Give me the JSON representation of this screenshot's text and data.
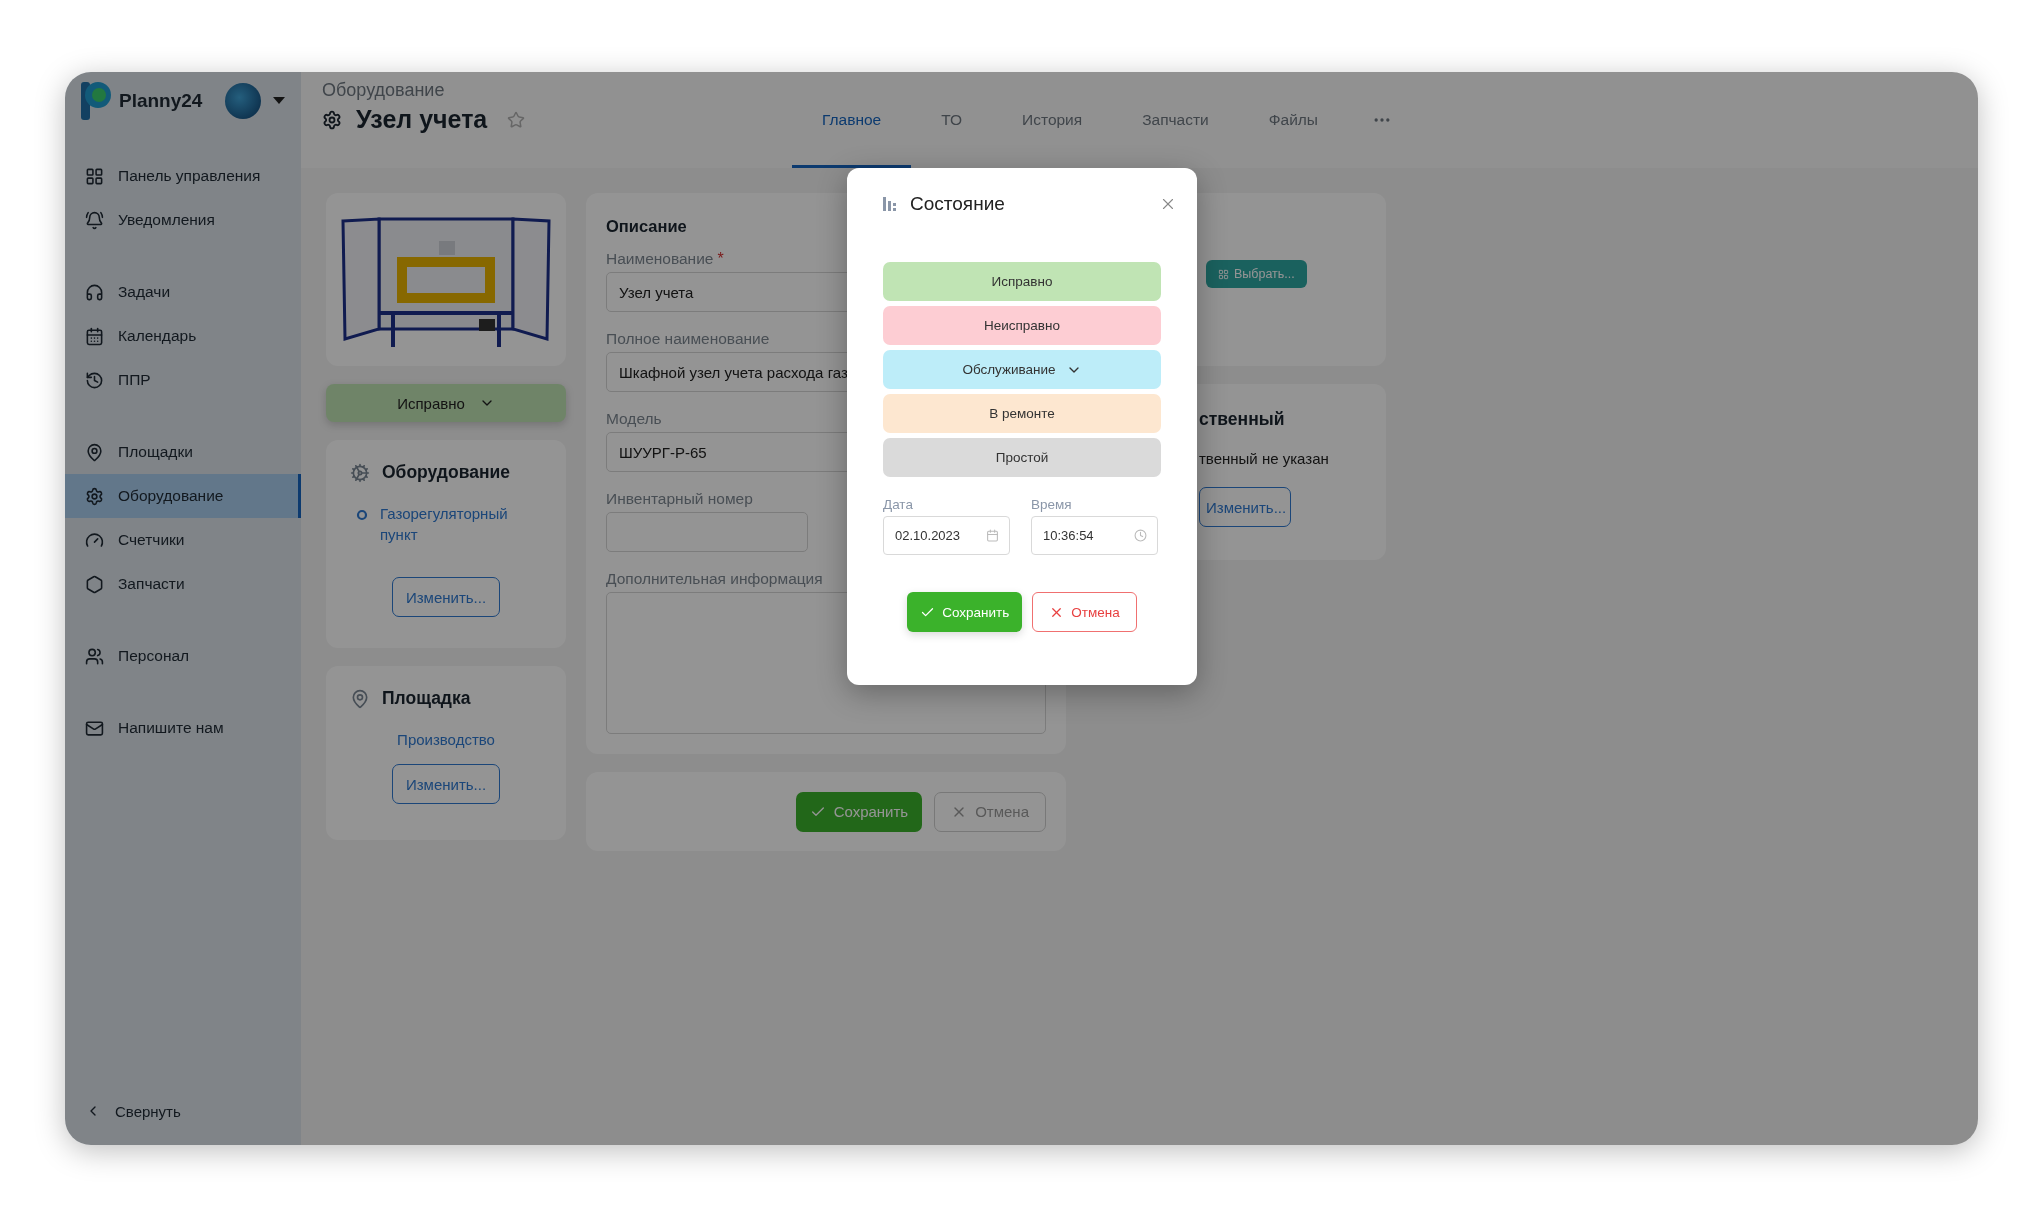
{
  "app": {
    "name": "Planny24"
  },
  "sidebar": {
    "groups": [
      [
        {
          "label": "Панель управления",
          "selected": false
        },
        {
          "label": "Уведомления",
          "selected": false
        }
      ],
      [
        {
          "label": "Задачи",
          "selected": false
        },
        {
          "label": "Календарь",
          "selected": false
        },
        {
          "label": "ППР",
          "selected": false
        }
      ],
      [
        {
          "label": "Площадки",
          "selected": false
        },
        {
          "label": "Оборудование",
          "selected": true
        },
        {
          "label": "Счетчики",
          "selected": false
        },
        {
          "label": "Запчасти",
          "selected": false
        }
      ],
      [
        {
          "label": "Персонал",
          "selected": false
        }
      ],
      [
        {
          "label": "Напишите нам",
          "selected": false
        }
      ]
    ],
    "collapse": "Свернуть"
  },
  "header": {
    "breadcrumb": "Оборудование",
    "title": "Узел учета",
    "starred": false,
    "tabs": [
      {
        "label": "Главное",
        "selected": true
      },
      {
        "label": "ТО",
        "selected": false
      },
      {
        "label": "История",
        "selected": false
      },
      {
        "label": "Запчасти",
        "selected": false
      },
      {
        "label": "Файлы",
        "selected": false
      }
    ]
  },
  "status_button": {
    "label": "Исправно"
  },
  "equipment_card": {
    "title": "Оборудование",
    "items": [
      {
        "label": "Газорегуляторный пункт"
      }
    ],
    "button": "Изменить..."
  },
  "site_card": {
    "title": "Площадка",
    "link": "Производство",
    "button": "Изменить..."
  },
  "description": {
    "title": "Описание",
    "fields": [
      {
        "kind": "text",
        "label": "Наименование",
        "required_mark": "*",
        "value": "Узел учета"
      },
      {
        "kind": "text",
        "label": "Полное наименование",
        "value": "Шкафной узел учета расхода газ"
      },
      {
        "kind": "text",
        "label": "Модель",
        "value": "ШУУРГ-Р-65"
      },
      {
        "kind": "half",
        "label": "Инвентарный номер"
      },
      {
        "kind": "textarea",
        "label": "Дополнительная информация"
      }
    ]
  },
  "form_actions": {
    "save": "Сохранить",
    "cancel": "Отмена"
  },
  "right_top_card": {
    "button": "Выбрать..."
  },
  "responsible_card": {
    "title": "ственный",
    "note": "твенный не указан",
    "button": "Изменить..."
  },
  "modal": {
    "title": "Состояние",
    "statuses": [
      {
        "label": "Исправно",
        "color": "#c0e4b4",
        "has_menu": false
      },
      {
        "label": "Неисправно",
        "color": "#fdcdd3",
        "has_menu": false
      },
      {
        "label": "Обслуживание",
        "color": "#bdedf9",
        "has_menu": true
      },
      {
        "label": "В ремонте",
        "color": "#fde7d0",
        "has_menu": false
      },
      {
        "label": "Простой",
        "color": "#dadada",
        "has_menu": false
      }
    ],
    "date_label": "Дата",
    "date": "02.10.2023",
    "time_label": "Время",
    "time": "10:36:54",
    "save": "Сохранить",
    "cancel": "Отмена"
  }
}
